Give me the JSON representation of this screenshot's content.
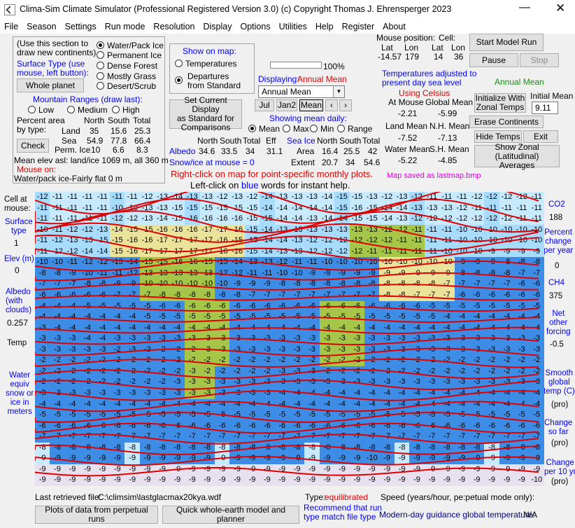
{
  "title": "Clima-Sim Climate Simulator (Professional Registered Version 3.0)    (c) Copyright Thomas J. Ehrensperger 2023",
  "menu": [
    "File",
    "Season",
    "Settings",
    "Run mode",
    "Resolution",
    "Display",
    "Options",
    "Utilities",
    "Help",
    "Register",
    "About"
  ],
  "draw": {
    "intro": "(Use this section to",
    "intro2": "draw new continents)",
    "surface_label": "Surface Type (use",
    "surface_label2": "mouse, left button):",
    "whole_planet": "Whole planet",
    "types": [
      "Water/Pack Ice",
      "Permanent Ice",
      "Dense Forest",
      "Mostly Grass",
      "Desert/Scrub"
    ],
    "mountain": "Mountain Ranges (draw last):",
    "low": "Low",
    "medium": "Medium",
    "high": "High",
    "pct1": "Percent area",
    "pct2": "by type:",
    "check": "Check",
    "north": "North",
    "south": "South",
    "total": "Total",
    "land": "Land",
    "land_n": "35",
    "land_s": "15.6",
    "land_t": "25.3",
    "sea": "Sea",
    "sea_n": "54.9",
    "sea_s": "77.8",
    "sea_t": "66.4",
    "ice": "Perm. Ice",
    "ice_n": "10",
    "ice_s": "6.6",
    "ice_t": "8.3",
    "mean_elev": "Mean elev asl: land/ice  1069 m, all  360 m",
    "mouse_on": "Mouse on:",
    "mouse_val": "Water/pack ice-Fairly flat 0 m"
  },
  "show": {
    "label": "Show on map:",
    "temps": "Temperatures",
    "dep1": "Departures",
    "dep2": "from Standard",
    "pct": "100%",
    "set1": "Set Current Display",
    "set2": "as Standard for",
    "set3": "Comparisons",
    "displaying": "Displaying:",
    "disp_val": "Annual Mean",
    "select": "Annual Mean",
    "jul": "Jul",
    "jan2": "Jan2",
    "mean": "Mean",
    "showing": "Showing mean daily:",
    "opt_mean": "Mean",
    "opt_max": "Max",
    "opt_min": "Min",
    "opt_range": "Range"
  },
  "albedo": {
    "label": "Albedo",
    "n": "34.6",
    "s": "33.5",
    "t": "34",
    "eff": "31.1",
    "north": "North",
    "south": "South",
    "total": "Total",
    "effh": "Eff",
    "seaice": "Sea Ice",
    "area": "Area",
    "area_n": "16.4",
    "area_s": "25.5",
    "area_t": "42",
    "extent": "Extent",
    "ext_n": "20.7",
    "ext_s": "34",
    "ext_t": "54.6",
    "snow": "Snow/ice at mouse = 0"
  },
  "hint1": "Right-click on map for point-specific monthly plots.",
  "hint2a": "Left-click on",
  "hint2b": "blue",
  "hint2c": "words for instant help.",
  "mouse": {
    "pos": "Mouse position:",
    "cell": "Cell:",
    "lat": "Lat",
    "lon": "Lon",
    "lat_v": "-14.57",
    "lon_v": "179",
    "clat": "14",
    "clon": "36",
    "adj1": "Temperatures adjusted to",
    "adj2": "present day sea level",
    "celsius": "Using Celsius",
    "at_mouse": "At Mouse",
    "global_mean": "Global Mean",
    "am_v": "-2.21",
    "gm_v": "-5.99",
    "land_mean": "Land Mean",
    "nh_mean": "N.H. Mean",
    "lm_v": "-7.52",
    "nh_v": "-7.13",
    "water_mean": "Water Mean",
    "sh_mean": "S.H. Mean",
    "wm_v": "-5.22",
    "sh_v": "-4.85"
  },
  "right": {
    "start": "Start Model Run",
    "pause": "Pause",
    "stop": "Stop",
    "annual": "Annual Mean",
    "init1": "Initialize  With",
    "init2": "Zonal Temps",
    "initial": "Initial Mean",
    "init_val": "9.11",
    "erase": "Erase Continents",
    "hide": "Hide Temps",
    "exit": "Exit",
    "zonal1": "Show Zonal (Latitudinal)",
    "zonal2": "Averages",
    "saved": "Map saved as lastmap.bmp"
  },
  "left": {
    "cell1": "Cell at",
    "cell2": "mouse:",
    "surf1": "Surface",
    "surf2": "type",
    "surf_v": "1",
    "elev": "Elev (m)",
    "elev_v": "0",
    "alb1": "Albedo",
    "alb2": "(with",
    "alb3": "clouds)",
    "alb_v": "0.257",
    "temp": "Temp",
    "w1": "Water",
    "w2": "equiv",
    "w3": "snow or",
    "w4": "ice in",
    "w5": "meters"
  },
  "side": {
    "co2": "CO2",
    "co2_v": "188",
    "pc1": "Percent",
    "pc2": "change",
    "pc3": "per year",
    "pc_v": "0",
    "ch4": "CH4",
    "ch4_v": "375",
    "net1": "Net",
    "net2": "other",
    "net3": "forcing",
    "net_v": "-0.5",
    "sm1": "Smooth",
    "sm2": "global",
    "sm3": "temp (C)",
    "pro": "(pro)",
    "ch1": "Change",
    "ch2": "so far",
    "pro2": "(pro)",
    "cp1": "Change",
    "cp2": "per 10 yr",
    "pro3": "(pro)"
  },
  "bottom": {
    "last": "Last retrieved file:",
    "file": "C:\\climsim\\lastglacmax20kya.wdf",
    "type": "Type:",
    "type_v": "equilibrated",
    "speed": "Speed (years/hour, pe:petual mode only):",
    "plots": "Plots of data from perpetual runs",
    "quick": "Quick whole-earth model and planner",
    "rec1": "Recommend that run",
    "rec2": "type match file type",
    "guidance": "Modern-day guidance global temperature:",
    "na": "N/A"
  },
  "grid_rows": [
    [
      -12,
      -11,
      -11,
      -11,
      -11,
      -11,
      -11,
      -12,
      -13,
      -14,
      -13,
      -13,
      -12,
      -13,
      -12,
      -14,
      -13,
      -13,
      -13,
      -14,
      -15,
      -15,
      -13,
      -12,
      -13,
      -12,
      -11,
      -11,
      -11,
      -12,
      -12,
      -12,
      -12,
      -11
    ],
    [
      -11,
      -11,
      -11,
      -11,
      -11,
      -10,
      -10,
      -13,
      -13,
      -15,
      -15,
      -15,
      -15,
      -15,
      -15,
      -14,
      -14,
      -14,
      -14,
      -14,
      -15,
      -16,
      -15,
      -14,
      -14,
      -13,
      -13,
      -13,
      -12,
      -11,
      -11,
      -11,
      -11,
      -11
    ],
    [
      -11,
      -11,
      -11,
      -11,
      -11,
      -12,
      -12,
      -13,
      -14,
      -15,
      -16,
      -16,
      -16,
      -16,
      -15,
      -15,
      -14,
      -14,
      -13,
      -14,
      -14,
      -15,
      -15,
      -14,
      -13,
      -12,
      -12,
      -12,
      -12,
      -12,
      -12,
      -12,
      -11,
      -11
    ],
    [
      -10,
      -11,
      -12,
      -12,
      -13,
      -14,
      -15,
      -15,
      -16,
      -16,
      -16,
      -17,
      -17,
      -16,
      -15,
      -14,
      -13,
      -13,
      -13,
      -13,
      -13,
      -13,
      -13,
      -12,
      -12,
      -11,
      -11,
      -11,
      -10,
      -10,
      -10,
      -10,
      -10,
      -10
    ],
    [
      -11,
      -12,
      -13,
      -13,
      -15,
      -15,
      -16,
      -16,
      -17,
      -17,
      -17,
      -17,
      -16,
      -15,
      -15,
      -14,
      -14,
      -13,
      -12,
      -12,
      -12,
      -12,
      -12,
      -12,
      -11,
      -11,
      -11,
      -11,
      -10,
      -10,
      -10,
      -10,
      -10,
      -10
    ],
    [
      -11,
      -12,
      -12,
      -14,
      -14,
      -15,
      -16,
      -17,
      -17,
      -17,
      -17,
      -17,
      -16,
      -16,
      -15,
      -14,
      -13,
      -13,
      -12,
      -12,
      -12,
      -12,
      -11,
      -11,
      -11,
      -11,
      -11,
      -10,
      -10,
      -10,
      -9,
      -9,
      -9,
      -9
    ],
    [
      -10,
      -10,
      -11,
      -12,
      -12,
      -13,
      -14,
      -15,
      -15,
      -16,
      -16,
      -15,
      -15,
      -14,
      -13,
      -13,
      -12,
      -11,
      -11,
      -10,
      -10,
      -10,
      -10,
      -10,
      -10,
      -10,
      -10,
      -10,
      -9,
      -9,
      -9,
      -8,
      -8,
      -8
    ],
    [
      -8,
      -8,
      -9,
      -10,
      -11,
      -11,
      -12,
      -13,
      -13,
      -13,
      -13,
      -13,
      -12,
      -12,
      -11,
      -11,
      -10,
      -10,
      -9,
      -9,
      -9,
      -9,
      -9,
      -9,
      -9,
      -9,
      -9,
      -9,
      -8,
      -8,
      -8,
      -8,
      -7,
      -7
    ],
    [
      -7,
      -7,
      -7,
      -8,
      -8,
      -9,
      -9,
      -10,
      -10,
      -10,
      -10,
      -10,
      -10,
      -9,
      -9,
      -9,
      -8,
      -8,
      -8,
      -8,
      -8,
      -8,
      -8,
      -8,
      -8,
      -8,
      -8,
      -7,
      -7,
      -7,
      -7,
      -7,
      -6,
      -6
    ],
    [
      -6,
      -6,
      -6,
      -6,
      -6,
      -7,
      -7,
      -7,
      -8,
      -8,
      -8,
      -8,
      -8,
      -8,
      -7,
      -7,
      -7,
      -7,
      -7,
      -7,
      -7,
      -7,
      -7,
      -8,
      -8,
      -7,
      -7,
      -7,
      -6,
      -6,
      -6,
      -6,
      -6,
      -6
    ],
    [
      -4,
      -4,
      -4,
      -5,
      -5,
      -5,
      -5,
      -5,
      -6,
      -6,
      -6,
      -6,
      -6,
      -6,
      -6,
      -6,
      -6,
      -6,
      -6,
      -6,
      -6,
      -6,
      -6,
      -6,
      -6,
      -6,
      -5,
      -5,
      -5,
      -5,
      -5,
      -5,
      -5,
      -5
    ],
    [
      -4,
      -4,
      -4,
      -4,
      -4,
      -4,
      -4,
      -5,
      -5,
      -5,
      -5,
      -5,
      -5,
      -5,
      -5,
      -5,
      -5,
      -5,
      -5,
      -5,
      -5,
      -5,
      -5,
      -5,
      -5,
      -5,
      -5,
      -4,
      -4,
      -4,
      -4,
      -4,
      -4,
      -4
    ],
    [
      -3,
      -4,
      -4,
      -4,
      -4,
      -4,
      -4,
      -4,
      -4,
      -4,
      -4,
      -4,
      -4,
      -4,
      -4,
      -4,
      -4,
      -4,
      -4,
      -4,
      -4,
      -4,
      -4,
      -4,
      -4,
      -4,
      -4,
      -4,
      -4,
      -4,
      -4,
      -4,
      -4,
      -4
    ],
    [
      -3,
      -3,
      -3,
      -4,
      -4,
      -3,
      -3,
      -3,
      -3,
      -3,
      -3,
      -3,
      -3,
      -3,
      -3,
      -3,
      -3,
      -3,
      -3,
      -3,
      -3,
      -3,
      -3,
      -3,
      -3,
      -3,
      -3,
      -3,
      -3,
      -3,
      -3,
      -3,
      -3,
      -3
    ],
    [
      -3,
      -3,
      -3,
      -3,
      -3,
      -2,
      -3,
      -2,
      -2,
      -2,
      -2,
      -3,
      -3,
      -3,
      -3,
      -3,
      -3,
      -3,
      -3,
      -3,
      -3,
      -3,
      -3,
      -3,
      -3,
      -3,
      -3,
      -3,
      -3,
      -3,
      -3,
      -3,
      -3,
      -3
    ],
    [
      -2,
      -2,
      -2,
      -2,
      -2,
      -2,
      -2,
      -2,
      -2,
      -2,
      -2,
      -2,
      -2,
      -2,
      -2,
      -2,
      -2,
      -2,
      -2,
      -2,
      -2,
      -2,
      -2,
      -2,
      -2,
      -2,
      -2,
      -2,
      -2,
      -2,
      -2,
      -2,
      -2,
      -2
    ],
    [
      -2,
      -2,
      -2,
      -2,
      -2,
      -2,
      -2,
      -2,
      -2,
      -2,
      -3,
      -2,
      -2,
      -2,
      -2,
      -2,
      -3,
      -3,
      -3,
      -2,
      -2,
      -2,
      -2,
      -2,
      -2,
      -2,
      -2,
      -2,
      -2,
      -2,
      -2,
      -2,
      -2,
      -2
    ],
    [
      -2,
      -2,
      -2,
      -2,
      -2,
      -2,
      -2,
      -2,
      -2,
      -3,
      -3,
      -3,
      -3,
      -3,
      -3,
      -3,
      -3,
      -3,
      -3,
      -3,
      -3,
      -3,
      -3,
      -3,
      -3,
      -3,
      -3,
      -3,
      -3,
      -3,
      -3,
      -3,
      -3,
      -3
    ],
    [
      -3,
      -3,
      -3,
      -3,
      -3,
      -3,
      -3,
      -3,
      -3,
      -3,
      -3,
      -3,
      -3,
      -3,
      -3,
      -3,
      -4,
      -4,
      -4,
      -4,
      -4,
      -4,
      -4,
      -4,
      -4,
      -4,
      -4,
      -4,
      -4,
      -4,
      -4,
      -4,
      -4,
      -4
    ],
    [
      -4,
      -4,
      -4,
      -4,
      -4,
      -4,
      -4,
      -4,
      -4,
      -4,
      -4,
      -4,
      -4,
      -4,
      -4,
      -4,
      -4,
      -4,
      -4,
      -4,
      -4,
      -4,
      -4,
      -4,
      -4,
      -4,
      -4,
      -4,
      -4,
      -4,
      -4,
      -4,
      -4,
      -4
    ],
    [
      -5,
      -5,
      -5,
      -5,
      -5,
      -5,
      -5,
      -5,
      -5,
      -5,
      -5,
      -5,
      -5,
      -5,
      -5,
      -5,
      -5,
      -5,
      -5,
      -5,
      -5,
      -5,
      -5,
      -5,
      -5,
      -5,
      -5,
      -5,
      -5,
      -5,
      -5,
      -5,
      -5,
      -5
    ],
    [
      -6,
      -6,
      -6,
      -6,
      -6,
      -6,
      -6,
      -6,
      -6,
      -6,
      -6,
      -6,
      -6,
      -6,
      -6,
      -6,
      -6,
      -6,
      -6,
      -6,
      -6,
      -6,
      -6,
      -6,
      -6,
      -6,
      -6,
      -6,
      -6,
      -6,
      -6,
      -6,
      -6,
      -6
    ],
    [
      -7,
      -7,
      -7,
      -7,
      -7,
      -7,
      -7,
      -7,
      -7,
      -7,
      -7,
      -7,
      -7,
      -7,
      -7,
      -7,
      -7,
      -7,
      -7,
      -7,
      -7,
      -7,
      -7,
      -7,
      -7,
      -7,
      -7,
      -7,
      -7,
      -7,
      -7,
      -7,
      -7,
      -7
    ],
    [
      -8,
      -8,
      -8,
      -8,
      -8,
      -8,
      -8,
      -8,
      -8,
      -8,
      -8,
      -8,
      -8,
      -8,
      -8,
      -8,
      -8,
      -8,
      -8,
      -8,
      -8,
      -8,
      -8,
      -8,
      -8,
      -8,
      -8,
      -8,
      -8,
      -8,
      -8,
      -8,
      -8,
      -8
    ],
    [
      -9,
      -9,
      -9,
      -9,
      -9,
      -9,
      -9,
      -9,
      -9,
      -9,
      -9,
      -9,
      -9,
      -9,
      -9,
      -9,
      -9,
      -9,
      -9,
      -9,
      -9,
      -9,
      -10,
      -9,
      -9,
      -9,
      -9,
      -9,
      -9,
      -9,
      -9,
      -9,
      -9,
      -9
    ],
    [
      -9,
      -9,
      -9,
      -9,
      -9,
      -9,
      -9,
      -9,
      -9,
      -9,
      -9,
      -9,
      -9,
      -9,
      -9,
      -9,
      -9,
      -9,
      -9,
      -9,
      -9,
      -9,
      -9,
      -9,
      -9,
      -9,
      -9,
      -9,
      -9,
      -9,
      -9,
      -9,
      -9,
      -9
    ],
    [
      -9,
      -9,
      -9,
      -9,
      -9,
      -9,
      -9,
      -9,
      -9,
      -9,
      -9,
      -9,
      -9,
      -9,
      -9,
      -9,
      -9,
      -9,
      -9,
      -9,
      -9,
      -9,
      -9,
      -9,
      -9,
      -9,
      -9,
      -9,
      -9,
      -9,
      -9,
      -9,
      -9,
      -10
    ]
  ],
  "colors": {
    "ice": "#c8eaff",
    "ice2": "#a8dcff",
    "water": "#3d8de6",
    "grass": "#a6c64a",
    "desert": "#ece39a",
    "forest": "#3e9e3e",
    "tundra": "#e6e0ef",
    "contour": "#e00000"
  }
}
